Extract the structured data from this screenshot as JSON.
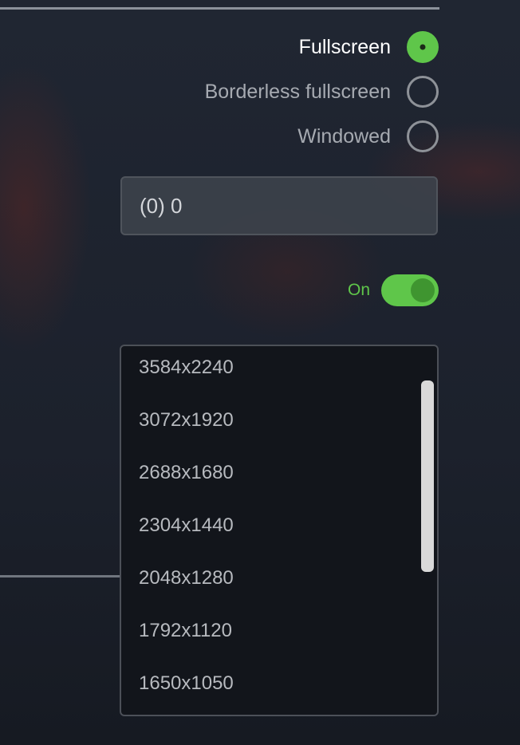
{
  "display_mode": {
    "options": [
      {
        "label": "Fullscreen",
        "selected": true
      },
      {
        "label": "Borderless fullscreen",
        "selected": false
      },
      {
        "label": "Windowed",
        "selected": false
      }
    ]
  },
  "monitor": {
    "value": "(0) 0"
  },
  "toggle": {
    "label": "On",
    "state": true
  },
  "resolution": {
    "options": [
      "3584x2240",
      "3072x1920",
      "2688x1680",
      "2304x1440",
      "2048x1280",
      "1792x1120",
      "1650x1050"
    ]
  },
  "colors": {
    "accent": "#5fc64a",
    "dropdown_bg": "#12151b"
  }
}
